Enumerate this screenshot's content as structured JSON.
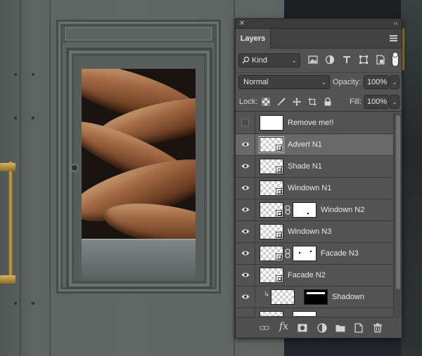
{
  "panel": {
    "close_glyph": "✕",
    "collapse_glyph": "‹‹",
    "tab_label": "Layers",
    "filter_kind": "Kind",
    "blend_mode": "Normal",
    "opacity_label": "Opacity:",
    "opacity_value": "100%",
    "lock_label": "Lock:",
    "fill_label": "Fill:",
    "fill_value": "100%"
  },
  "layers": [
    {
      "name": "Remove me!!",
      "visible": false,
      "thumb": "white",
      "selected": false
    },
    {
      "name": "Advert N1",
      "visible": true,
      "thumb": "checker-smart",
      "selected": true
    },
    {
      "name": "Shade N1",
      "visible": true,
      "thumb": "checker-smart",
      "selected": false
    },
    {
      "name": "Windown N1",
      "visible": true,
      "thumb": "checker-smart",
      "selected": false
    },
    {
      "name": "Windown N2",
      "visible": true,
      "thumb": "checker-smart-mask",
      "selected": false
    },
    {
      "name": "Windown N3",
      "visible": true,
      "thumb": "checker-smart",
      "selected": false
    },
    {
      "name": "Facade N3",
      "visible": true,
      "thumb": "checker-smart-mask",
      "selected": false
    },
    {
      "name": "Facade N2",
      "visible": true,
      "thumb": "checker-smart",
      "selected": false
    },
    {
      "name": "Shadown",
      "visible": true,
      "thumb": "clipped-mask-black",
      "selected": false
    }
  ],
  "icons": {
    "filter": [
      "search-icon",
      "image-filter-icon",
      "adjustment-filter-icon",
      "type-filter-icon",
      "shape-filter-icon",
      "smart-object-filter-icon"
    ],
    "lock": [
      "lock-transparent-pixels-icon",
      "lock-image-pixels-icon",
      "lock-position-icon",
      "lock-artboard-icon",
      "lock-all-icon"
    ],
    "bottom": [
      "link-layers-icon",
      "fx-icon",
      "add-mask-icon",
      "adjustment-layer-icon",
      "group-folder-icon",
      "new-layer-icon",
      "trash-icon"
    ]
  },
  "colors": {
    "panel_bg": "#535353",
    "selected_row": "#696969",
    "header_bg": "#424242"
  }
}
